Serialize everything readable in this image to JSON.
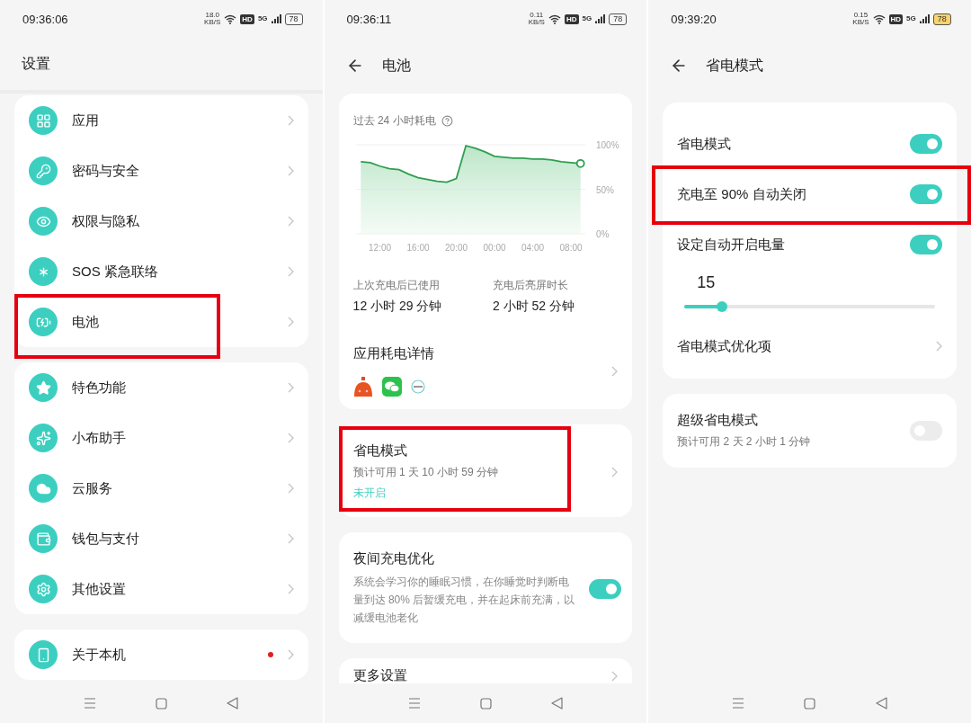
{
  "settings_screen": {
    "status_bar": {
      "time": "09:36:06",
      "speed": "18.0",
      "speed_unit": "KB/S",
      "hd": "HD",
      "network": "5G",
      "battery": "78",
      "battery_saver": false
    },
    "header": {
      "title": "设置",
      "back_arrow": false
    },
    "groups": [
      {
        "items": [
          {
            "label": "应用",
            "badge": false,
            "highlighted": false
          },
          {
            "label": "密码与安全",
            "badge": false,
            "highlighted": false
          },
          {
            "label": "权限与隐私",
            "badge": false,
            "highlighted": false
          },
          {
            "label": "SOS 紧急联络",
            "badge": false,
            "highlighted": false
          },
          {
            "label": "电池",
            "badge": false,
            "highlighted": true
          }
        ]
      },
      {
        "items": [
          {
            "label": "特色功能",
            "badge": false,
            "highlighted": false
          },
          {
            "label": "小布助手",
            "badge": false,
            "highlighted": false
          },
          {
            "label": "云服务",
            "badge": false,
            "highlighted": false
          },
          {
            "label": "钱包与支付",
            "badge": false,
            "highlighted": false
          },
          {
            "label": "其他设置",
            "badge": false,
            "highlighted": false
          }
        ]
      },
      {
        "items": [
          {
            "label": "关于本机",
            "badge": true,
            "highlighted": false
          }
        ]
      }
    ]
  },
  "battery_screen": {
    "status_bar": {
      "time": "09:36:11",
      "speed": "0.11",
      "speed_unit": "KB/S",
      "hd": "HD",
      "network": "5G",
      "battery": "78",
      "battery_saver": false
    },
    "header": {
      "title": "电池",
      "back_arrow": true
    },
    "usage_card": {
      "title": "过去 24 小时耗电",
      "chart_data": {
        "type": "area",
        "categories": [
          null,
          null,
          "12:00",
          null,
          null,
          null,
          "16:00",
          null,
          null,
          null,
          "20:00",
          null,
          null,
          null,
          "00:00",
          null,
          null,
          null,
          "04:00",
          null,
          null,
          null,
          "08:00",
          null
        ],
        "series": [
          {
            "color": "#2e9e4f",
            "values": [
              81,
              80,
              76,
              73,
              72,
              67,
              63,
              61,
              59,
              58,
              62,
              99,
              96,
              92,
              87,
              86,
              85,
              85,
              84,
              84,
              83,
              81,
              80,
              79
            ]
          }
        ],
        "ylim": [
          0,
          100
        ],
        "yticks": [
          {
            "value": 0,
            "label": "0%"
          },
          {
            "value": 50,
            "label": "50%"
          },
          {
            "value": 100,
            "label": "100%"
          }
        ]
      },
      "stats": [
        {
          "label": "上次充电后已使用",
          "value": "12 小时 29 分钟"
        },
        {
          "label": "充电后亮屏时长",
          "value": "2 小时 52 分钟"
        }
      ],
      "app_usage": {
        "title": "应用耗电详情"
      }
    },
    "power_saving_card": {
      "title": "省电模式",
      "subtitle": "预计可用 1 天 10 小时 59 分钟",
      "status": "未开启",
      "highlighted": true
    },
    "night_charging_card": {
      "title": "夜间充电优化",
      "description": "系统会学习你的睡眠习惯，在你睡觉时判断电量到达 80% 后暂缓充电，并在起床前充满，以减缓电池老化",
      "on": true
    },
    "more_card": {
      "title": "更多设置"
    }
  },
  "power_saving_screen": {
    "status_bar": {
      "time": "09:39:20",
      "speed": "0.15",
      "speed_unit": "KB/S",
      "hd": "HD",
      "network": "5G",
      "battery": "78",
      "battery_saver": true
    },
    "header": {
      "title": "省电模式",
      "back_arrow": true
    },
    "main_card": {
      "rows": [
        {
          "kind": "toggle",
          "label": "省电模式",
          "on": true,
          "highlighted": false
        },
        {
          "kind": "toggle",
          "label": "充电至 90% 自动关闭",
          "on": true,
          "highlighted": true
        },
        {
          "kind": "toggle",
          "label": "设定自动开启电量",
          "on": true,
          "highlighted": false
        },
        {
          "kind": "slider",
          "value": "15",
          "level": 0.15,
          "highlighted": false
        },
        {
          "kind": "link",
          "label": "省电模式优化项",
          "highlighted": false
        }
      ]
    },
    "super_card": {
      "title": "超级省电模式",
      "subtitle": "预计可用 2 天 2 小时 1 分钟",
      "on": false
    }
  }
}
